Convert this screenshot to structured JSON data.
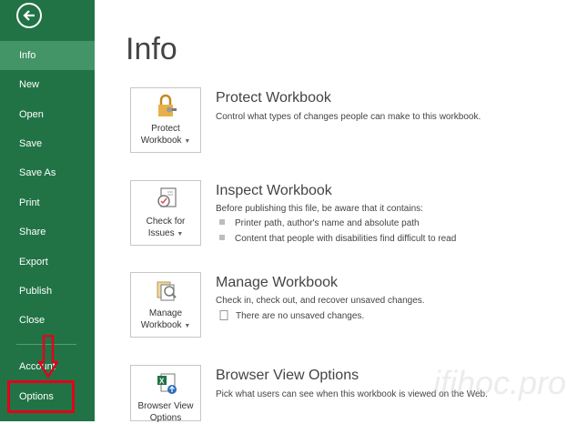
{
  "sidebar": {
    "back_icon": "back-arrow-icon",
    "items": [
      {
        "label": "Info",
        "active": true
      },
      {
        "label": "New"
      },
      {
        "label": "Open"
      },
      {
        "label": "Save"
      },
      {
        "label": "Save As"
      },
      {
        "label": "Print"
      },
      {
        "label": "Share"
      },
      {
        "label": "Export"
      },
      {
        "label": "Publish"
      },
      {
        "label": "Close"
      },
      {
        "label": "Account"
      },
      {
        "label": "Options"
      }
    ]
  },
  "main": {
    "title": "Info",
    "sections": [
      {
        "tile_line1": "Protect",
        "tile_line2": "Workbook",
        "title": "Protect Workbook",
        "desc": "Control what types of changes people can make to this workbook."
      },
      {
        "tile_line1": "Check for",
        "tile_line2": "Issues",
        "title": "Inspect Workbook",
        "desc": "Before publishing this file, be aware that it contains:",
        "bullets": [
          "Printer path, author's name and absolute path",
          "Content that people with disabilities find difficult to read"
        ]
      },
      {
        "tile_line1": "Manage",
        "tile_line2": "Workbook",
        "title": "Manage Workbook",
        "desc": "Check in, check out, and recover unsaved changes.",
        "note": "There are no unsaved changes."
      },
      {
        "tile_line1": "Browser View",
        "tile_line2": "Options",
        "title": "Browser View Options",
        "desc": "Pick what users can see when this workbook is viewed on the Web."
      }
    ]
  },
  "watermark": "ifihoc.pro",
  "colors": {
    "sidebar": "#217346",
    "active": "#439467",
    "highlight": "#e3001b"
  }
}
